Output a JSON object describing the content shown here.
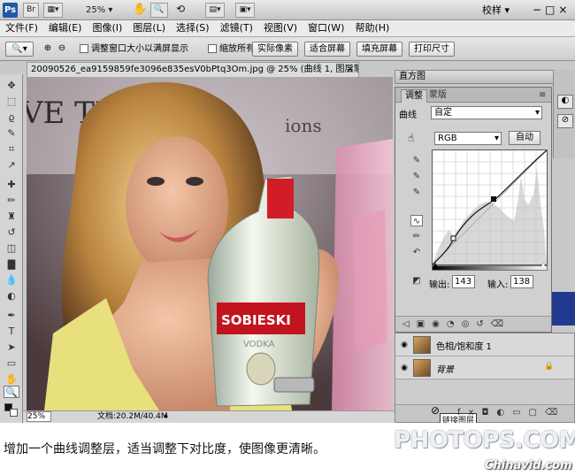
{
  "app": {
    "logo": "Ps",
    "mini_bridge": "Br",
    "zoom": "25%",
    "workspace": "校样",
    "window_controls": "−□×"
  },
  "menu": [
    "文件(F)",
    "编辑(E)",
    "图像(I)",
    "图层(L)",
    "选择(S)",
    "滤镜(T)",
    "视图(V)",
    "窗口(W)",
    "帮助(H)"
  ],
  "options": {
    "resize_windows": "调整窗口大小以满屏显示",
    "zoom_all": "缩放所有窗口",
    "actual_pixels": "实际像素",
    "fit_screen": "适合屏幕",
    "fill_screen": "填充屏幕",
    "print_size": "打印尺寸"
  },
  "document": {
    "tab_title": "20090526_ea9159859fe3096e835esV0bPtq3Om.jpg @ 25% (曲线 1, 图层蒙版/8) *",
    "close": "×",
    "status_zoom": "25%",
    "status_doc": "文档:20.2M/40.4M"
  },
  "canvas_text": {
    "banner": "VE TH",
    "banner2": "ions",
    "brand": "SOBIESKI",
    "sub": "VODKA"
  },
  "panels": {
    "histogram_title": "直方图",
    "adj_tab_active": "调整",
    "adj_tab_other": "蒙版",
    "curves_label": "曲线",
    "preset": "自定",
    "channel": "RGB",
    "auto": "自动",
    "output_label": "输出:",
    "output_value": "143",
    "input_label": "输入:",
    "input_value": "138"
  },
  "layers": [
    {
      "name": "色相/饱和度 1",
      "lock": ""
    },
    {
      "name": "背景",
      "lock": "🔒"
    }
  ],
  "layers_footer_text": "链接图层",
  "caption": "增加一个曲线调整层，适当调整下对比度，使图像更清晰。",
  "watermark": {
    "main": "PHOTOPS.COM",
    "sub": "Chinavid.com"
  }
}
